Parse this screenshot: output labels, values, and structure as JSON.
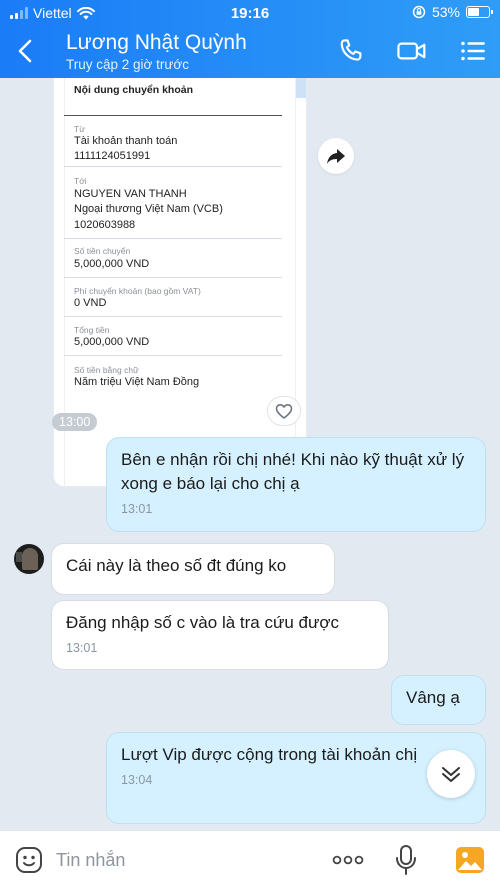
{
  "status_bar": {
    "carrier": "Viettel",
    "time": "19:16",
    "battery": "53%",
    "battery_level": 0.53,
    "icons": [
      "signal-icon",
      "wifi-icon",
      "orientation-lock-icon",
      "battery-icon"
    ]
  },
  "header": {
    "title": "Lương Nhật Quỳnh",
    "subtitle": "Truy cập 2 giờ trước",
    "icons": [
      "back-icon",
      "phone-icon",
      "video-call-icon",
      "menu-icon"
    ]
  },
  "receipt": {
    "section_title": "Nội dung chuyển khoản",
    "from_label": "Từ",
    "from_account_type": "Tài khoản thanh toán",
    "from_account_number": "1111124051991",
    "to_label": "Tới",
    "to_name": "NGUYEN VAN THANH",
    "to_bank": "Ngoại thương Việt Nam (VCB)",
    "to_account_number": "1020603988",
    "amount_label": "Số tiền chuyển",
    "amount_value": "5,000,000 VND",
    "fee_label": "Phí chuyển khoản (bao gồm VAT)",
    "fee_value": "0 VND",
    "total_label": "Tổng tiền",
    "total_value": "5,000,000 VND",
    "words_label": "Số tiền bằng chữ",
    "words_value": "Năm triệu Việt Nam Đồng",
    "time": "13:00"
  },
  "messages": [
    {
      "direction": "out",
      "text": "Bên e nhận rồi chị nhé! Khi nào kỹ thuật xử lý xong e báo lại cho chị ạ",
      "time": "13:01"
    },
    {
      "direction": "in",
      "text": "Cái này là theo số đt đúng ko",
      "time": ""
    },
    {
      "direction": "in",
      "text": "Đăng nhập số c vào là tra cứu được",
      "time": "13:01"
    },
    {
      "direction": "out",
      "text": "Vâng ạ",
      "time": ""
    },
    {
      "direction": "out",
      "text": "Lượt Vip được cộng trong tài khoản chị",
      "time": "13:04"
    }
  ],
  "input_bar": {
    "placeholder": "Tin nhắn",
    "icons": [
      "emoji-icon",
      "more-icon",
      "microphone-icon",
      "photo-icon"
    ]
  },
  "colors": {
    "header": "#1a7cf7",
    "chat_background": "#e2e9f1",
    "outgoing_bubble": "#d5f1ff",
    "incoming_bubble": "#ffffff",
    "accent_photo": "#f5a623"
  }
}
